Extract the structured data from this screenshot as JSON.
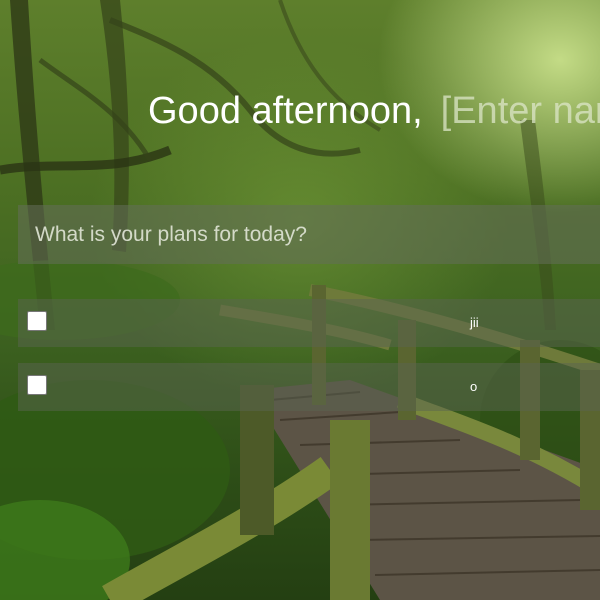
{
  "greeting": {
    "text": "Good afternoon,",
    "name_placeholder": "[Enter name]"
  },
  "plans": {
    "placeholder": "What is your plans for today?"
  },
  "todos": [
    {
      "text": "jii",
      "checked": false
    },
    {
      "text": "o",
      "checked": false
    }
  ]
}
